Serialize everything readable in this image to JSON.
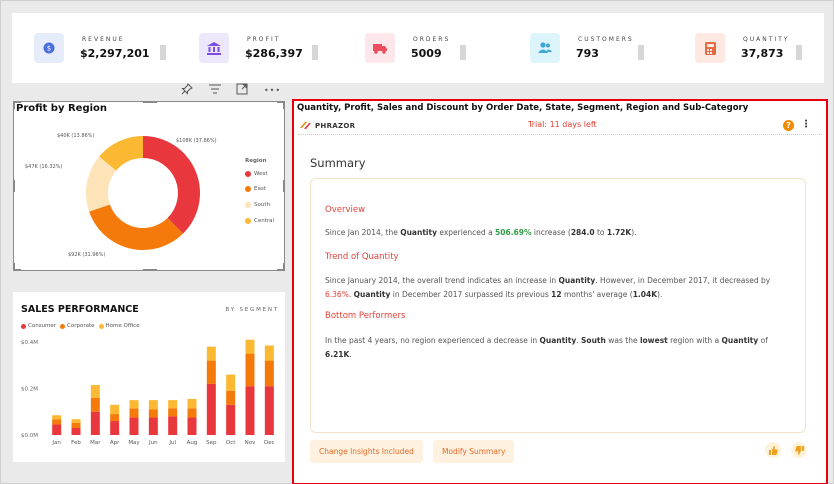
{
  "kpis": [
    {
      "label": "REVENUE",
      "value": "$2,297,201",
      "icon": "dollar-coin-icon",
      "bg": "#e7ecfb",
      "fg": "#4a6ee0"
    },
    {
      "label": "PROFIT",
      "value": "$286,397",
      "icon": "bank-icon",
      "bg": "#ede7fb",
      "fg": "#7b4ce0"
    },
    {
      "label": "ORDERS",
      "value": "5009",
      "icon": "truck-icon",
      "bg": "#fde7ea",
      "fg": "#ee4d5f"
    },
    {
      "label": "CUSTOMERS",
      "value": "793",
      "icon": "users-icon",
      "bg": "#def4fb",
      "fg": "#3fa7d8"
    },
    {
      "label": "QUANTITY",
      "value": "37,873",
      "icon": "calculator-icon",
      "bg": "#fde9e2",
      "fg": "#e36a43"
    }
  ],
  "toolbar": {
    "icons": [
      "pin-icon",
      "filter-icon",
      "focus-mode-icon",
      "more-options-icon"
    ],
    "more_label": "•••"
  },
  "donut": {
    "title": "Profit by Region",
    "legend_title": "Region",
    "slices": [
      {
        "name": "West",
        "value": 108,
        "label": "$108K (37.86%)",
        "color": "#e8373d"
      },
      {
        "name": "East",
        "value": 92,
        "label": "$92K (31.96%)",
        "color": "#f57a0c"
      },
      {
        "name": "South",
        "value": 47,
        "label": "$47K (16.32%)",
        "color": "#fde4b8"
      },
      {
        "name": "Central",
        "value": 40,
        "label": "$40K (13.86%)",
        "color": "#fbb833"
      }
    ]
  },
  "chart_data": {
    "type": "bar",
    "stacked": true,
    "title": "SALES PERFORMANCE",
    "subtitle": "BY SEGMENT",
    "categories": [
      "Jan",
      "Feb",
      "Mar",
      "Apr",
      "May",
      "Jun",
      "Jul",
      "Aug",
      "Sep",
      "Oct",
      "Nov",
      "Dec"
    ],
    "series": [
      {
        "name": "Consumer",
        "color": "#e8373d",
        "values": [
          0.045,
          0.03,
          0.1,
          0.06,
          0.075,
          0.075,
          0.08,
          0.075,
          0.22,
          0.13,
          0.21,
          0.21
        ]
      },
      {
        "name": "Corporate",
        "color": "#f57a0c",
        "values": [
          0.022,
          0.022,
          0.06,
          0.03,
          0.04,
          0.035,
          0.035,
          0.04,
          0.1,
          0.06,
          0.14,
          0.11
        ]
      },
      {
        "name": "Home Office",
        "color": "#fbb833",
        "values": [
          0.018,
          0.016,
          0.055,
          0.04,
          0.035,
          0.04,
          0.035,
          0.04,
          0.06,
          0.07,
          0.06,
          0.065
        ]
      }
    ],
    "yticks": [
      "$0.0M",
      "$0.2M",
      "$0.4M"
    ],
    "ylim": [
      0,
      0.4
    ],
    "grid": false
  },
  "summary": {
    "panel_title": "Quantity, Profit, Sales and Discount by Order Date, State, Segment, Region and Sub-Category",
    "brand": "PHRAZOR",
    "trial": "Trial: 11 days left",
    "help": "?",
    "menu": "⋮",
    "heading": "Summary",
    "overview": {
      "title": "Overview",
      "t1": "Since Jan  2014, the ",
      "k1": "Quantity",
      "t2": " experienced a ",
      "pct": "506.69%",
      "t3": " increase (",
      "v1": "284.0",
      "t4": " to ",
      "v2": "1.72K",
      "t5": ")."
    },
    "trend": {
      "title": "Trend of Quantity",
      "t1": "Since January  2014, the overall trend indicates an increase in ",
      "k1": "Quantity",
      "t2": ". However, in December  2017, it decreased by ",
      "pct": "6.36%",
      "t3": ". ",
      "k2": "Quantity",
      "t4": " in December  2017 surpassed its previous ",
      "n": "12",
      "t5": " months' average (",
      "v": "1.04K",
      "t6": ")."
    },
    "bottom": {
      "title": "Bottom Performers",
      "t1": "In the past 4 years, no region experienced a decrease in ",
      "k1": "Quantity",
      "t2": ". ",
      "k2": "South",
      "t3": " was the ",
      "k3": "lowest",
      "t4": " region with a ",
      "k4": "Quantity",
      "t5": " of ",
      "v": "6.21K",
      "t6": "."
    },
    "buttons": {
      "change": "Change Insights Included",
      "modify": "Modify Summary"
    }
  }
}
